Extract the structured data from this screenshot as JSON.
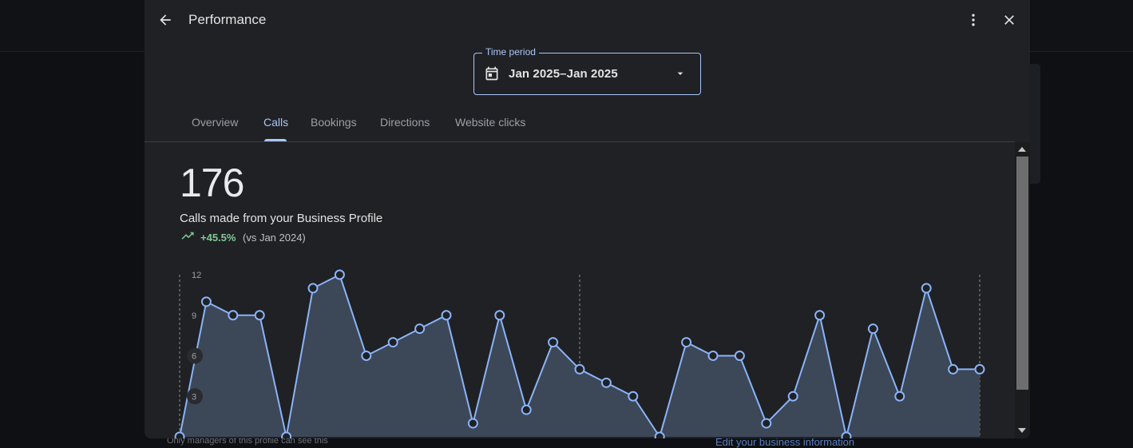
{
  "header": {
    "title": "Performance",
    "back_icon": "arrow-back-icon",
    "more_icon": "more-vert-icon",
    "close_icon": "close-icon"
  },
  "time_period": {
    "label": "Time period",
    "value": "Jan 2025–Jan 2025",
    "icon": "calendar-icon"
  },
  "tabs": [
    {
      "label": "Overview",
      "active": false
    },
    {
      "label": "Calls",
      "active": true
    },
    {
      "label": "Bookings",
      "active": false
    },
    {
      "label": "Directions",
      "active": false
    },
    {
      "label": "Website clicks",
      "active": false
    }
  ],
  "metric": {
    "value": "176",
    "label": "Calls made from your Business Profile",
    "change": "+45.5%",
    "comparison": "(vs Jan 2024)",
    "trend_icon": "trending-up-icon"
  },
  "chart_data": {
    "type": "area",
    "x": [
      1,
      2,
      3,
      4,
      5,
      6,
      7,
      8,
      9,
      10,
      11,
      12,
      13,
      14,
      15,
      16,
      17,
      18,
      19,
      20,
      21,
      22,
      23,
      24,
      25,
      26,
      27,
      28,
      29,
      30,
      31
    ],
    "values": [
      0,
      10,
      9,
      9,
      0,
      11,
      12,
      6,
      7,
      8,
      9,
      1,
      9,
      2,
      7,
      5,
      4,
      3,
      0,
      7,
      6,
      6,
      1,
      3,
      9,
      0,
      8,
      3,
      11,
      5,
      5
    ],
    "y_ticks": [
      "12",
      "9",
      "6",
      "3"
    ],
    "ylim": [
      0,
      12
    ],
    "colors": {
      "line": "#8ab4f8",
      "fill": "#3c4758"
    }
  },
  "background": {
    "footer_left": "Only managers of this profile can see this",
    "footer_right": "Edit your business information"
  },
  "colors": {
    "accent": "#a8c7fa",
    "positive": "#81c995",
    "dialog_bg": "#202124"
  }
}
